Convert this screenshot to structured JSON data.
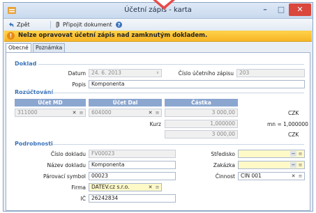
{
  "window": {
    "title": "Účetní zápis - karta"
  },
  "toolbar": {
    "back_label": "Zpět",
    "attach_label": "Připojit dokument"
  },
  "warning": {
    "text": "Nelze opravovat účetní zápis nad zamknutým dokladem."
  },
  "tabs": [
    {
      "label": "Obecné"
    },
    {
      "label": "Poznámka"
    }
  ],
  "doklad": {
    "section_title": "Doklad",
    "datum_label": "Datum",
    "datum_value": "24. 6. 2013",
    "cislo_label": "Číslo účetního zápisu",
    "cislo_value": "203",
    "popis_label": "Popis",
    "popis_value": "Komponenta"
  },
  "rozuctovani": {
    "section_title": "Rozúčtování",
    "col_md": "Účet MD",
    "col_dal": "Účet Dal",
    "col_castka": "Částka",
    "md_value": "311000",
    "dal_value": "604000",
    "castka_value": "3 000,00",
    "castka_currency": "CZK",
    "kurz_label": "Kurz",
    "kurz_value": "1,000000",
    "kurz_note": "mn = 1,000000",
    "total_value": "3 000,00",
    "total_currency": "CZK"
  },
  "podrobnosti": {
    "section_title": "Podrobnosti",
    "cislo_dokladu_label": "Číslo dokladu",
    "cislo_dokladu_value": "FV00023",
    "nazev_label": "Název dokladu",
    "nazev_value": "Komponenta",
    "parovaci_label": "Párovací symbol",
    "parovaci_value": "00023",
    "firma_label": "Firma",
    "firma_value": "DATEV.cz s.r.o.",
    "ic_label": "IČ",
    "ic_value": "26242834",
    "stredisko_label": "Středisko",
    "stredisko_value": "",
    "zakazka_label": "Zakázka",
    "zakazka_value": "",
    "cinnost_label": "Činnost",
    "cinnost_value": "CIN 001"
  },
  "colors": {
    "accent": "#3b73b9",
    "warning": "#f7b626",
    "close": "#d9473d"
  }
}
